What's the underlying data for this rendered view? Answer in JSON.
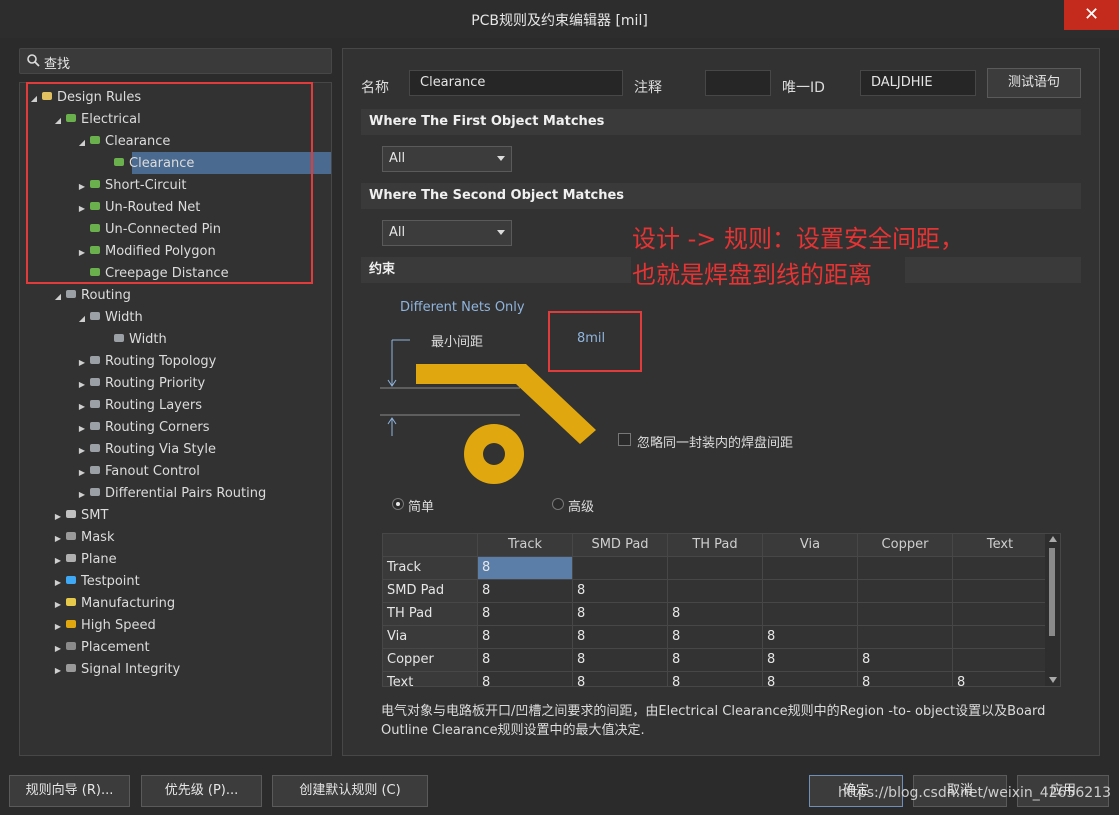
{
  "window": {
    "title": "PCB规则及约束编辑器 [mil]",
    "close_glyph": "✕"
  },
  "search": {
    "placeholder": "查找"
  },
  "tree": [
    {
      "label": "Design Rules",
      "depth": 0,
      "expanded": true,
      "icon": "design-rules-icon"
    },
    {
      "label": "Electrical",
      "depth": 1,
      "expanded": true,
      "icon": "electrical-rule-icon"
    },
    {
      "label": "Clearance",
      "depth": 2,
      "expanded": true,
      "icon": "electrical-rule-icon"
    },
    {
      "label": "Clearance",
      "depth": 3,
      "selected": true,
      "icon": "electrical-rule-icon"
    },
    {
      "label": "Short-Circuit",
      "depth": 2,
      "expanded": false,
      "icon": "electrical-rule-icon"
    },
    {
      "label": "Un-Routed Net",
      "depth": 2,
      "expanded": false,
      "icon": "electrical-rule-icon"
    },
    {
      "label": "Un-Connected Pin",
      "depth": 2,
      "icon": "electrical-rule-icon"
    },
    {
      "label": "Modified Polygon",
      "depth": 2,
      "expanded": false,
      "icon": "electrical-rule-icon"
    },
    {
      "label": "Creepage Distance",
      "depth": 2,
      "icon": "electrical-rule-icon"
    },
    {
      "label": "Routing",
      "depth": 1,
      "expanded": true,
      "icon": "routing-rule-icon"
    },
    {
      "label": "Width",
      "depth": 2,
      "expanded": true,
      "icon": "routing-rule-icon"
    },
    {
      "label": "Width",
      "depth": 3,
      "icon": "routing-rule-icon"
    },
    {
      "label": "Routing Topology",
      "depth": 2,
      "expanded": false,
      "icon": "routing-rule-icon"
    },
    {
      "label": "Routing Priority",
      "depth": 2,
      "expanded": false,
      "icon": "routing-rule-icon"
    },
    {
      "label": "Routing Layers",
      "depth": 2,
      "expanded": false,
      "icon": "routing-rule-icon"
    },
    {
      "label": "Routing Corners",
      "depth": 2,
      "expanded": false,
      "icon": "routing-rule-icon"
    },
    {
      "label": "Routing Via Style",
      "depth": 2,
      "expanded": false,
      "icon": "routing-rule-icon"
    },
    {
      "label": "Fanout Control",
      "depth": 2,
      "expanded": false,
      "icon": "routing-rule-icon"
    },
    {
      "label": "Differential Pairs Routing",
      "depth": 2,
      "expanded": false,
      "icon": "routing-rule-icon"
    },
    {
      "label": "SMT",
      "depth": 1,
      "expanded": false,
      "icon": "smt-rule-icon"
    },
    {
      "label": "Mask",
      "depth": 1,
      "expanded": false,
      "icon": "mask-rule-icon"
    },
    {
      "label": "Plane",
      "depth": 1,
      "expanded": false,
      "icon": "plane-rule-icon"
    },
    {
      "label": "Testpoint",
      "depth": 1,
      "expanded": false,
      "icon": "testpoint-rule-icon"
    },
    {
      "label": "Manufacturing",
      "depth": 1,
      "expanded": false,
      "icon": "manufacturing-rule-icon"
    },
    {
      "label": "High Speed",
      "depth": 1,
      "expanded": false,
      "icon": "high-speed-rule-icon"
    },
    {
      "label": "Placement",
      "depth": 1,
      "expanded": false,
      "icon": "placement-rule-icon"
    },
    {
      "label": "Signal Integrity",
      "depth": 1,
      "expanded": false,
      "icon": "signal-integrity-rule-icon"
    }
  ],
  "rule": {
    "name_label": "名称",
    "name_value": "Clearance",
    "comment_label": "注释",
    "comment_value": "",
    "uid_label": "唯一ID",
    "uid_value": "DALJDHIE",
    "test_button": "测试语句"
  },
  "first_match": {
    "header": "Where The First Object Matches",
    "value": "All"
  },
  "second_match": {
    "header": "Where The Second Object Matches",
    "value": "All"
  },
  "annotation": {
    "line1": "设计 -> 规则：设置安全间距，",
    "line2": "也就是焊盘到线的距离",
    "color": "#e63333"
  },
  "constraints": {
    "header": "约束",
    "net_scope": "Different Nets Only",
    "min_clearance_label": "最小间距",
    "min_clearance_value": "8mil",
    "ignore_pad_label": "忽略同一封装内的焊盘间距",
    "ignore_pad_checked": false,
    "mode_simple": "简单",
    "mode_advanced": "高级",
    "mode_selected": "simple",
    "graphic_color": "#e0a80e"
  },
  "matrix": {
    "columns": [
      "Track",
      "SMD Pad",
      "TH Pad",
      "Via",
      "Copper",
      "Text"
    ],
    "rows": [
      {
        "label": "Track",
        "values": [
          "8",
          "",
          "",
          "",
          "",
          ""
        ]
      },
      {
        "label": "SMD Pad",
        "values": [
          "8",
          "8",
          "",
          "",
          "",
          ""
        ]
      },
      {
        "label": "TH Pad",
        "values": [
          "8",
          "8",
          "8",
          "",
          "",
          ""
        ]
      },
      {
        "label": "Via",
        "values": [
          "8",
          "8",
          "8",
          "8",
          "",
          ""
        ]
      },
      {
        "label": "Copper",
        "values": [
          "8",
          "8",
          "8",
          "8",
          "8",
          ""
        ]
      },
      {
        "label": "Text",
        "values": [
          "8",
          "8",
          "8",
          "8",
          "8",
          "8"
        ]
      }
    ]
  },
  "description": {
    "line1": "电气对象与电路板开口/凹槽之间要求的间距，由Electrical Clearance规则中的Region -to- object设置以及Board",
    "line2": "Outline Clearance规则设置中的最大值决定."
  },
  "bottom": {
    "rule_wizard": "规则向导 (R)...",
    "priority": "优先级 (P)...",
    "create_default": "创建默认规则 (C)",
    "ok": "确定",
    "cancel": "取消",
    "apply": "应用"
  },
  "watermark": "https://blog.csdn.net/weixin_42656213"
}
